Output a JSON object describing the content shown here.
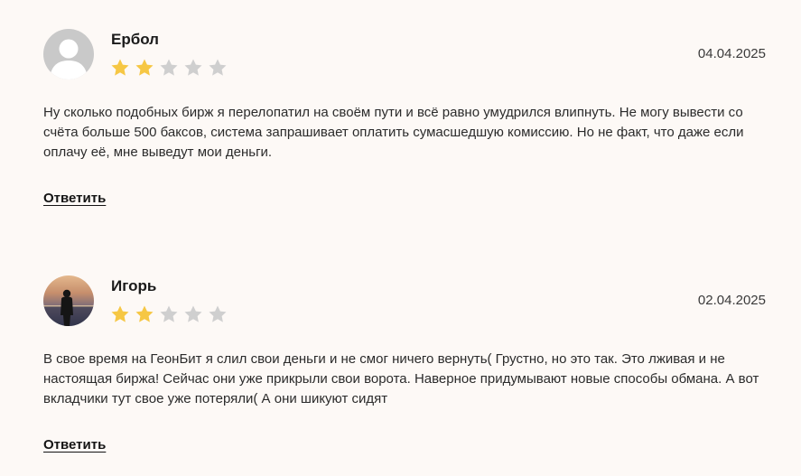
{
  "reviews": [
    {
      "author": "Ербол",
      "date": "04.04.2025",
      "rating": 2,
      "max_rating": 5,
      "avatar_icon": "user-silhouette-icon",
      "text": "Ну сколько подобных бирж я перелопатил на своём пути и всё равно умудрился влипнуть. Не могу вывести со счёта больше 500 баксов, система запрашивает оплатить сумасшедшую комиссию. Но не факт, что даже если оплачу её, мне выведут мои деньги.",
      "reply_label": "Ответить"
    },
    {
      "author": "Игорь",
      "date": "02.04.2025",
      "rating": 2,
      "max_rating": 5,
      "avatar_icon": "user-photo",
      "text": "В свое время на ГеонБит я слил свои деньги и не смог ничего вернуть( Грустно, но это так. Это лживая и не настоящая биржа! Сейчас они уже прикрыли свои ворота. Наверное придумывают новые способы обмана. А вот вкладчики тут свое уже потеряли( А они шикуют сидят",
      "reply_label": "Ответить"
    }
  ],
  "colors": {
    "star_filled": "#f6c744",
    "star_empty": "#cfcfcf",
    "background": "#fdf9f6"
  }
}
